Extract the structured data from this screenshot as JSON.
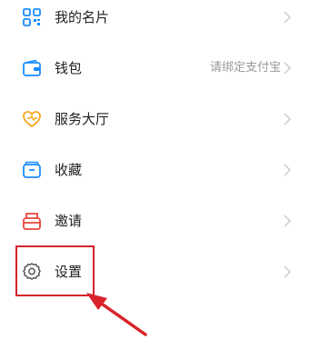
{
  "menu": {
    "items": [
      {
        "label": "我的名片",
        "icon": "qr-card-icon",
        "hint": ""
      },
      {
        "label": "钱包",
        "icon": "wallet-icon",
        "hint": "请绑定支付宝"
      },
      {
        "label": "服务大厅",
        "icon": "heart-service-icon",
        "hint": ""
      },
      {
        "label": "收藏",
        "icon": "favorites-box-icon",
        "hint": ""
      },
      {
        "label": "邀请",
        "icon": "invite-icon",
        "hint": ""
      },
      {
        "label": "设置",
        "icon": "gear-icon",
        "hint": ""
      }
    ]
  },
  "colors": {
    "accent_blue": "#1a8cff",
    "accent_orange": "#f5a623",
    "accent_red": "#e8443a",
    "annotation_red": "#d8232a",
    "chevron": "#c8c8c8"
  }
}
